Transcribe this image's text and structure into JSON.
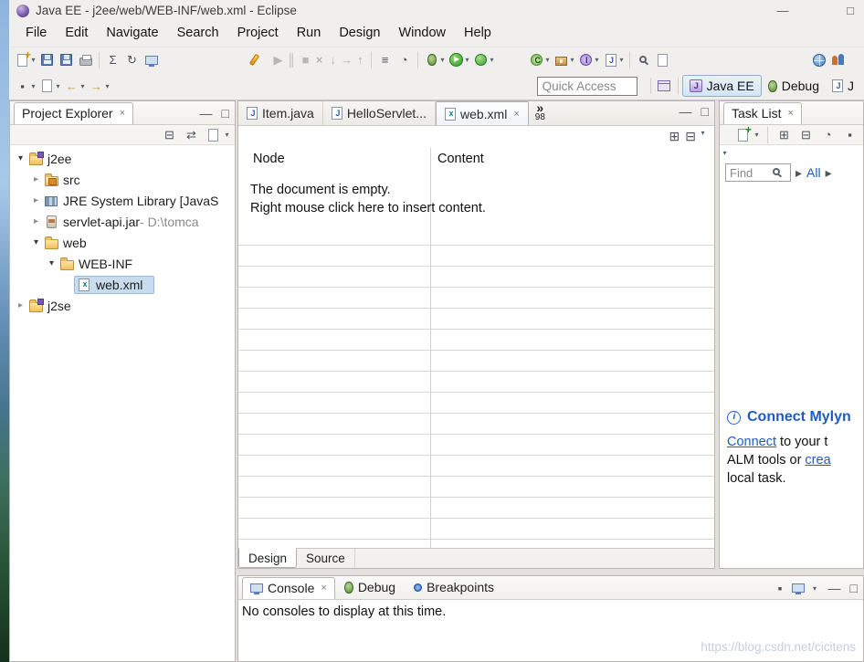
{
  "window": {
    "title": "Java EE - j2ee/web/WEB-INF/web.xml - Eclipse"
  },
  "menubar": {
    "items": [
      "File",
      "Edit",
      "Navigate",
      "Search",
      "Project",
      "Run",
      "Design",
      "Window",
      "Help"
    ]
  },
  "toolbar": {
    "quick_access_placeholder": "Quick Access",
    "perspectives": [
      {
        "label": "Java EE",
        "active": true
      },
      {
        "label": "Debug",
        "active": false
      },
      {
        "label": "J",
        "active": false
      }
    ]
  },
  "icons": {
    "new_wizard": "page-with-plus",
    "save": "floppy",
    "save_all": "floppy",
    "print": "printer",
    "sigma": "Σ",
    "refresh": "↻",
    "terminal": "monitor",
    "search": "flashlight",
    "resume": "▶",
    "suspend": "║",
    "terminate": "■",
    "disconnect": "×",
    "step_into": "↓",
    "step_over": "→",
    "step_return": "↑",
    "debug": "bug",
    "run": "green-play",
    "coverage": "green-circle",
    "new_class": "green-C",
    "new_package": "package",
    "new_interface": "purple-I",
    "new_file": "J-file",
    "open_type": "magnifier",
    "web_browser": "globe",
    "collaboration": "two-users",
    "back": "←",
    "forward": "→",
    "pin": "▪",
    "dropdown": "▾",
    "expand_all": "⊞",
    "collapse_all": "⊟",
    "link_editor": "⇄",
    "minimize": "—",
    "maximize": "□",
    "close": "×",
    "overflow": "»",
    "tree_expanded": "▾",
    "tree_collapsed": "▸",
    "info": "i",
    "find": "magnifier"
  },
  "project_explorer": {
    "title": "Project Explorer",
    "tree": [
      {
        "label": "j2ee",
        "state": "expanded",
        "icon": "project-folder"
      },
      {
        "label": "src",
        "state": "collapsed",
        "icon": "package-folder"
      },
      {
        "label": "JRE System Library [JavaS",
        "state": "collapsed",
        "icon": "library"
      },
      {
        "label": "servlet-api.jar",
        "suffix": " - D:\\tomca",
        "state": "collapsed",
        "icon": "jar"
      },
      {
        "label": "web",
        "state": "expanded",
        "icon": "folder"
      },
      {
        "label": "WEB-INF",
        "state": "expanded",
        "icon": "folder"
      },
      {
        "label": "web.xml",
        "state": "leaf",
        "icon": "xml-file",
        "selected": true
      },
      {
        "label": "j2se",
        "state": "collapsed",
        "icon": "project-folder"
      }
    ]
  },
  "editor": {
    "tabs": [
      {
        "label": "Item.java",
        "active": false
      },
      {
        "label": "HelloServlet...",
        "active": false
      },
      {
        "label": "web.xml",
        "active": true
      }
    ],
    "overflow_count": "98",
    "table": {
      "columns": [
        "Node",
        "Content"
      ]
    },
    "empty_message_line1": "The document is empty.",
    "empty_message_line2": "Right mouse click here to insert content.",
    "bottom_tabs": [
      {
        "label": "Design",
        "active": true
      },
      {
        "label": "Source",
        "active": false
      }
    ]
  },
  "task_list": {
    "title": "Task List",
    "find_placeholder": "Find",
    "all_label": "All",
    "mylyn": {
      "title": "Connect Mylyn",
      "link_connect": "Connect",
      "line1_rest": " to your t",
      "line2_pre": "ALM tools or ",
      "link_create": "crea",
      "line3": "local task."
    }
  },
  "console": {
    "tabs": [
      {
        "label": "Console",
        "active": true
      },
      {
        "label": "Debug",
        "active": false
      },
      {
        "label": "Breakpoints",
        "active": false
      }
    ],
    "message": "No consoles to display at this time."
  },
  "watermark": "https://blog.csdn.net/cicitens"
}
